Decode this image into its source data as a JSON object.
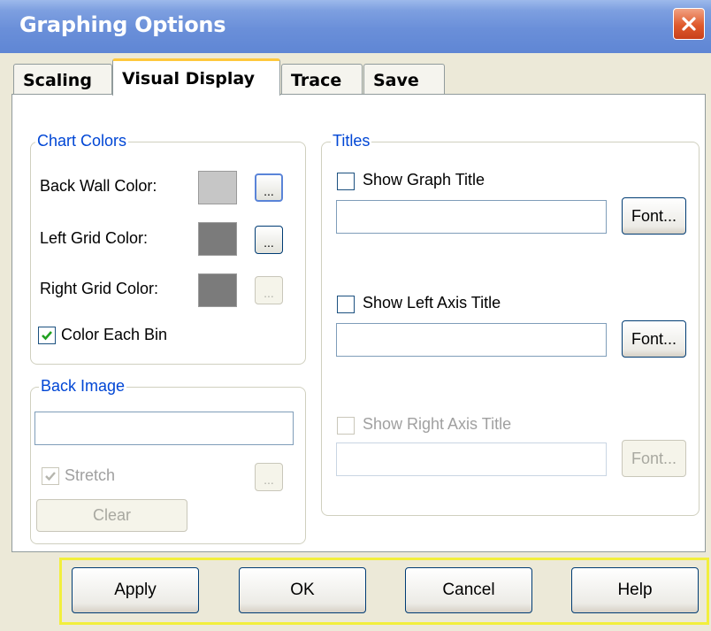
{
  "window": {
    "title": "Graphing Options"
  },
  "tabs": [
    {
      "label": "Scaling",
      "active": false
    },
    {
      "label": "Visual Display",
      "active": true
    },
    {
      "label": "Trace",
      "active": false
    },
    {
      "label": "Save",
      "active": false
    }
  ],
  "chart_colors": {
    "legend": "Chart Colors",
    "back_wall": {
      "label": "Back Wall Color:",
      "color": "#c6c6c6"
    },
    "left_grid": {
      "label": "Left Grid Color:",
      "color": "#7b7b7b"
    },
    "right_grid": {
      "label": "Right Grid Color:",
      "color": "#7b7b7b"
    },
    "browse_label": "...",
    "color_each_bin": {
      "label": "Color Each Bin",
      "checked": true
    }
  },
  "back_image": {
    "legend": "Back Image",
    "path_value": "",
    "stretch": {
      "label": "Stretch",
      "checked": true
    },
    "browse_label": "...",
    "clear_label": "Clear"
  },
  "titles": {
    "legend": "Titles",
    "graph": {
      "label": "Show Graph Title",
      "checked": false,
      "value": "",
      "font_label": "Font..."
    },
    "left_axis": {
      "label": "Show Left Axis Title",
      "checked": false,
      "value": "",
      "font_label": "Font..."
    },
    "right_axis": {
      "label": "Show Right Axis Title",
      "checked": false,
      "value": "",
      "font_label": "Font..."
    }
  },
  "footer": {
    "apply": "Apply",
    "ok": "OK",
    "cancel": "Cancel",
    "help": "Help"
  },
  "colors": {
    "highlight": "#f2ef3c",
    "legend_text": "#0046d5",
    "title_bar": "#6a8fd9"
  }
}
